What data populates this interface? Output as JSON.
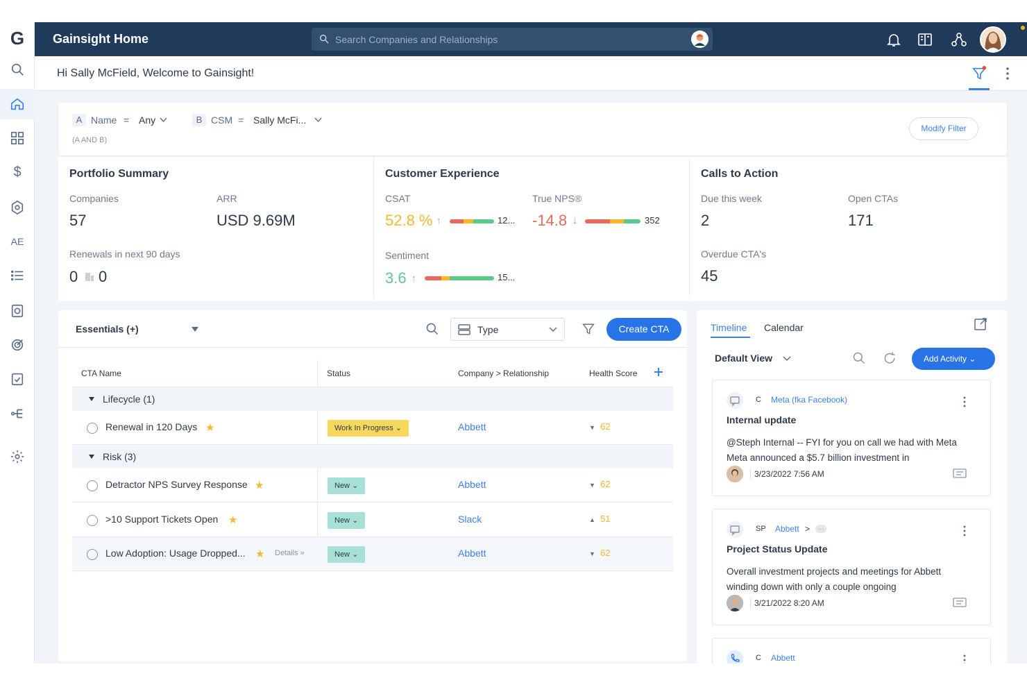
{
  "app": {
    "logo": "G",
    "title": "Gainsight Home",
    "search_placeholder": "Search Companies and Relationships",
    "welcome": "Hi Sally McField, Welcome to Gainsight!"
  },
  "nav": {
    "items": [
      {
        "icon": "search-icon"
      },
      {
        "icon": "home-icon",
        "active": true
      },
      {
        "icon": "dashboard-icon"
      },
      {
        "icon": "dollar-icon"
      },
      {
        "icon": "gear-badge-icon"
      },
      {
        "label": "AE"
      },
      {
        "icon": "list-icon"
      },
      {
        "icon": "timeline-icon"
      },
      {
        "icon": "target-icon"
      },
      {
        "icon": "checklist-icon"
      },
      {
        "icon": "journey-icon"
      },
      {
        "icon": "settings-icon"
      }
    ]
  },
  "filter": {
    "a_tag": "A",
    "a_field": "Name",
    "a_op": "=",
    "a_value": "Any",
    "b_tag": "B",
    "b_field": "CSM",
    "b_op": "=",
    "b_value": "Sally McFi...",
    "expression": "(A AND B)",
    "modify_label": "Modify Filter"
  },
  "portfolio": {
    "title": "Portfolio Summary",
    "companies_label": "Companies",
    "companies_value": "57",
    "arr_label": "ARR",
    "arr_value": "USD 9.69M",
    "renewals_label": "Renewals in next 90 days",
    "renewals_count": "0",
    "renewals_value": "0"
  },
  "experience": {
    "title": "Customer Experience",
    "csat_label": "CSAT",
    "csat_value": "52.8 %",
    "csat_count": "12...",
    "nps_label": "True NPS®",
    "nps_value": "-14.8",
    "nps_count": "352",
    "sentiment_label": "Sentiment",
    "sentiment_value": "3.6",
    "sentiment_count": "15..."
  },
  "cta_summary": {
    "title": "Calls to Action",
    "due_label": "Due this week",
    "due_value": "2",
    "open_label": "Open CTAs",
    "open_value": "171",
    "overdue_label": "Overdue CTA's",
    "overdue_value": "45"
  },
  "cta_panel": {
    "view": "Essentials (+)",
    "type_label": "Type",
    "create_label": "Create CTA",
    "columns": [
      "CTA Name",
      "Status",
      "Company > Relationship",
      "Health Score"
    ],
    "groups": [
      {
        "label": "Lifecycle (1)"
      },
      {
        "label": "Risk (3)"
      }
    ],
    "rows": [
      {
        "name": "Renewal in 120 Days",
        "status": "Work In Progress",
        "company": "Abbett",
        "health": "62",
        "trend": "down"
      },
      {
        "name": "Detractor NPS Survey Response",
        "status": "New",
        "company": "Abbett",
        "health": "62",
        "trend": "down"
      },
      {
        "name": ">10 Support Tickets Open",
        "status": "New",
        "company": "Slack",
        "health": "51",
        "trend": "up"
      },
      {
        "name": "Low Adoption: Usage Dropped...",
        "status": "New",
        "company": "Abbett",
        "health": "62",
        "trend": "down",
        "details": "Details »"
      }
    ]
  },
  "timeline": {
    "tab_timeline": "Timeline",
    "tab_calendar": "Calendar",
    "view": "Default View",
    "add_label": "Add Activity",
    "activities": [
      {
        "type": "C",
        "company": "Meta (fka Facebook)",
        "title": "Internal update",
        "body": "@Steph Internal -- FYI for you on call we had with Meta Meta announced a $5.7 billion investment in",
        "date": "3/23/2022 7:56 AM"
      },
      {
        "type": "SP",
        "company": "Abbett",
        "suffix": ">",
        "title": "Project Status Update",
        "body": "Overall investment projects and meetings for Abbett winding down with only a couple ongoing",
        "date": "3/21/2022 8:20 AM"
      },
      {
        "type": "C",
        "company": "Abbett"
      }
    ]
  },
  "colors": {
    "topbar": "#1f3a5a",
    "accent": "#2874e6",
    "csat": "#f5b82e",
    "nps": "#e86a5c",
    "sentiment": "#5ec98a",
    "status_wip": "#f7d85c",
    "status_new": "#a7e0d6"
  }
}
